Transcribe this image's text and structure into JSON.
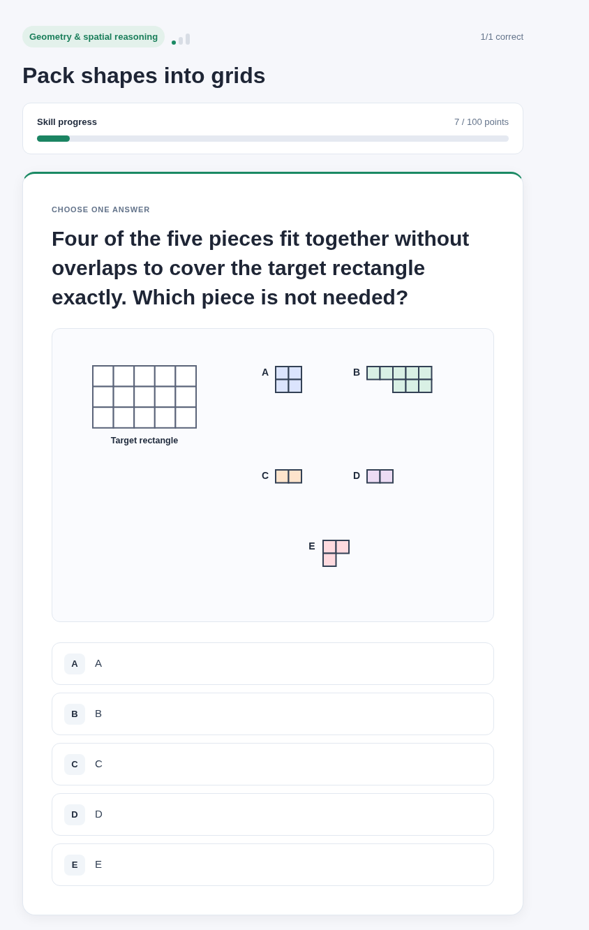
{
  "header": {
    "topic": "Geometry & spatial reasoning",
    "difficulty": [
      {
        "filled": true
      },
      {
        "filled": false
      },
      {
        "filled": false
      }
    ],
    "score": "1/1 correct"
  },
  "title": "Pack shapes into grids",
  "progress": {
    "label": "Skill progress",
    "points": "7 / 100 points",
    "level": 0.07
  },
  "question": {
    "eyebrow": "CHOOSE ONE ANSWER",
    "prompt": "Four of the five pieces fit together without overlaps to cover the target rectangle exactly. Which piece is not needed?",
    "figure": {
      "target": {
        "caption": "Target rectangle"
      },
      "pieces": [
        {
          "label": "A",
          "kind": "square",
          "color": "#dbe4fd"
        },
        {
          "label": "B",
          "kind": "step",
          "color": "#d9f0e5"
        },
        {
          "label": "C",
          "kind": "domino",
          "color": "#fee4cc"
        },
        {
          "label": "D",
          "kind": "domino",
          "color": "#ecdcf4"
        },
        {
          "label": "E",
          "kind": "corner",
          "color": "#fedadf"
        }
      ]
    },
    "options": [
      {
        "key": "A",
        "text": "A",
        "selected": false
      },
      {
        "key": "B",
        "text": "B",
        "selected": false
      },
      {
        "key": "C",
        "text": "C",
        "selected": false
      },
      {
        "key": "D",
        "text": "D",
        "selected": false
      },
      {
        "key": "E",
        "text": "E",
        "selected": false
      }
    ]
  }
}
